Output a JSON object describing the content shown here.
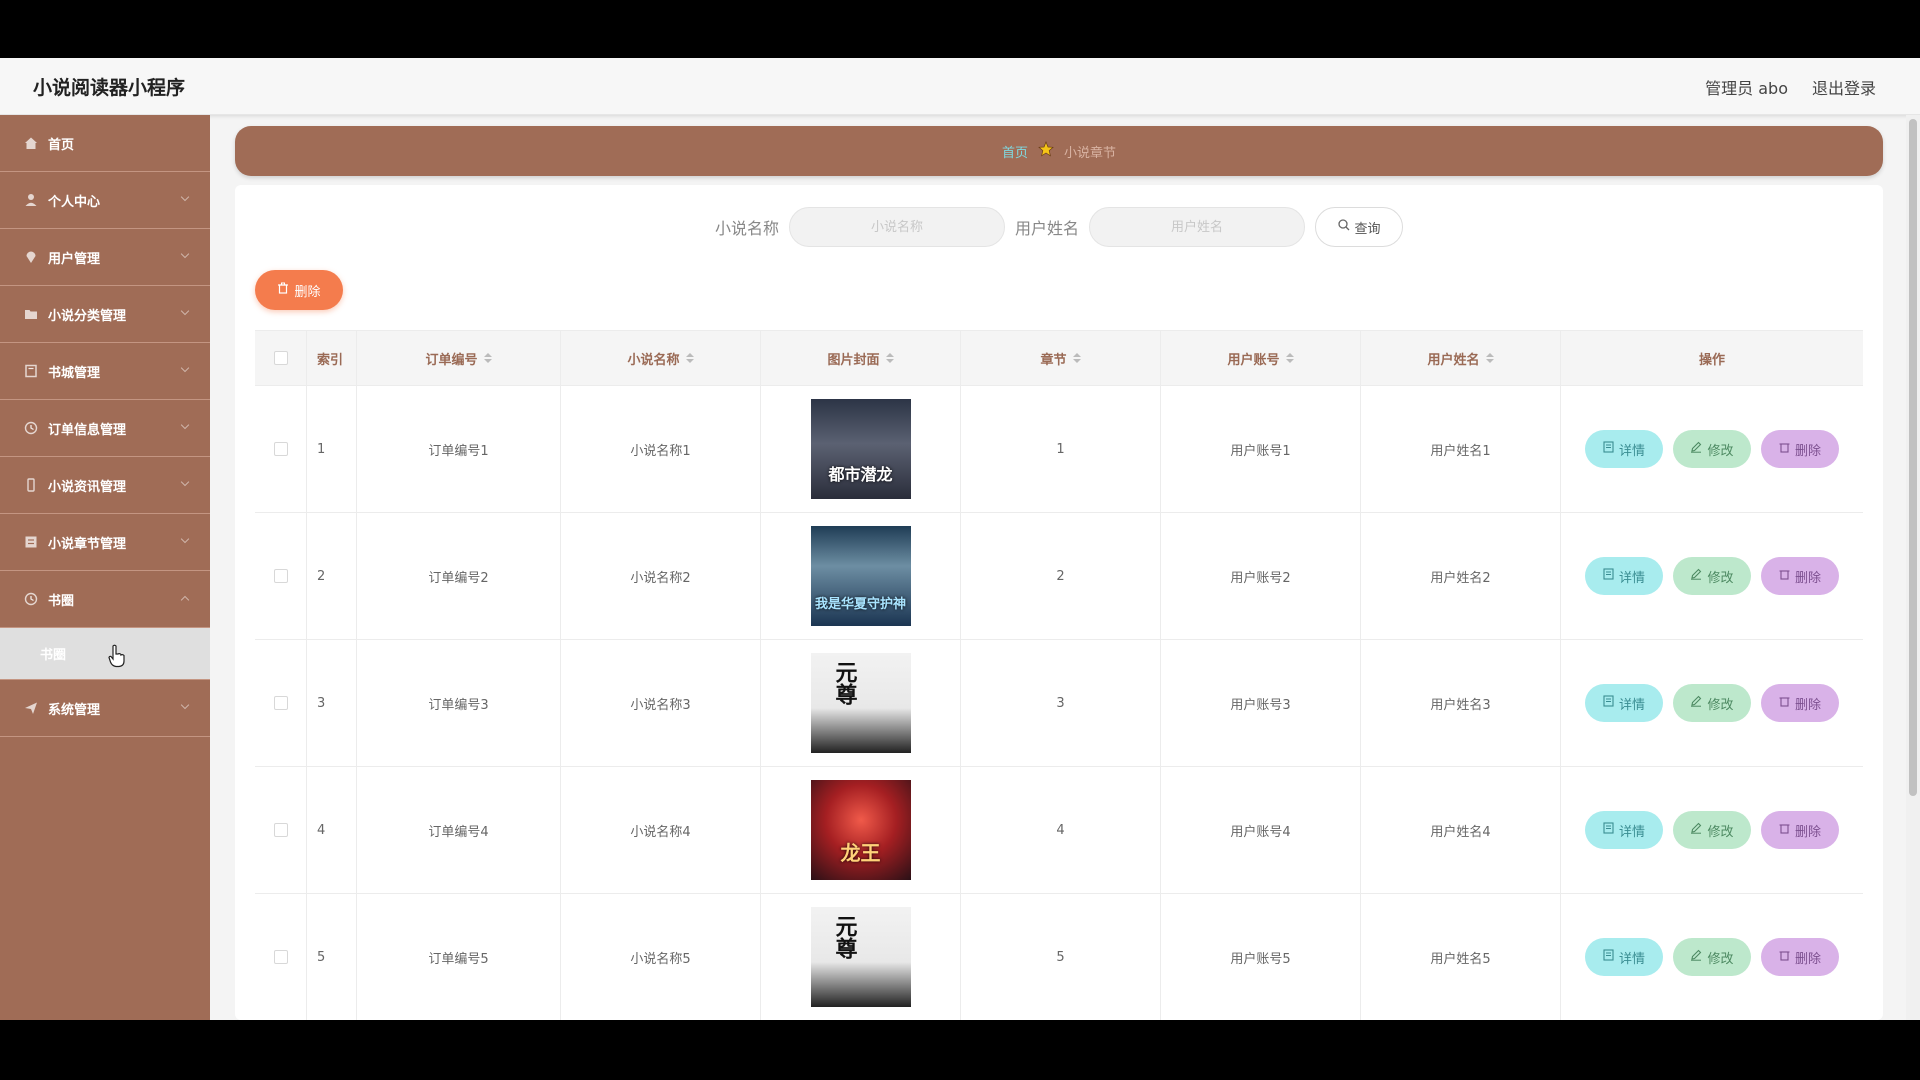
{
  "header": {
    "title": "小说阅读器小程序",
    "user": "管理员 abo",
    "logout": "退出登录"
  },
  "sidebar": {
    "items": [
      {
        "label": "首页",
        "icon": "home-icon"
      },
      {
        "label": "个人中心",
        "icon": "user-icon"
      },
      {
        "label": "用户管理",
        "icon": "map-pin-icon"
      },
      {
        "label": "小说分类管理",
        "icon": "folder-icon"
      },
      {
        "label": "书城管理",
        "icon": "book-icon"
      },
      {
        "label": "订单信息管理",
        "icon": "clock-icon"
      },
      {
        "label": "小说资讯管理",
        "icon": "phone-icon"
      },
      {
        "label": "小说章节管理",
        "icon": "list-icon"
      },
      {
        "label": "书圈",
        "icon": "circle-icon"
      },
      {
        "label": "系统管理",
        "icon": "send-icon"
      }
    ],
    "sub_item": "书圈"
  },
  "breadcrumb": {
    "home": "首页",
    "current": "小说章节"
  },
  "search": {
    "name_label": "小说名称",
    "name_placeholder": "小说名称",
    "user_label": "用户姓名",
    "user_placeholder": "用户姓名",
    "query_label": "查询"
  },
  "toolbar": {
    "delete_label": "删除"
  },
  "table": {
    "columns": [
      "索引",
      "订单编号",
      "小说名称",
      "图片封面",
      "章节",
      "用户账号",
      "用户姓名",
      "操作"
    ],
    "rows": [
      {
        "index": "1",
        "order": "订单编号1",
        "name": "小说名称1",
        "cover_title": "都市潜龙",
        "chapter": "1",
        "account": "用户账号1",
        "user": "用户姓名1"
      },
      {
        "index": "2",
        "order": "订单编号2",
        "name": "小说名称2",
        "cover_title": "我是华夏守护神",
        "chapter": "2",
        "account": "用户账号2",
        "user": "用户姓名2"
      },
      {
        "index": "3",
        "order": "订单编号3",
        "name": "小说名称3",
        "cover_title": "元尊",
        "chapter": "3",
        "account": "用户账号3",
        "user": "用户姓名3"
      },
      {
        "index": "4",
        "order": "订单编号4",
        "name": "小说名称4",
        "cover_title": "龙王",
        "chapter": "4",
        "account": "用户账号4",
        "user": "用户姓名4"
      },
      {
        "index": "5",
        "order": "订单编号5",
        "name": "小说名称5",
        "cover_title": "元尊",
        "chapter": "5",
        "account": "用户账号5",
        "user": "用户姓名5"
      }
    ],
    "actions": {
      "detail": "详情",
      "edit": "修改",
      "delete": "删除"
    }
  },
  "colors": {
    "sidebar_bg": "#a06c56",
    "accent_orange": "#f47c4d",
    "detail_btn": "#a8ecee",
    "edit_btn": "#bde8cc",
    "delete_btn": "#d9b2e8"
  }
}
